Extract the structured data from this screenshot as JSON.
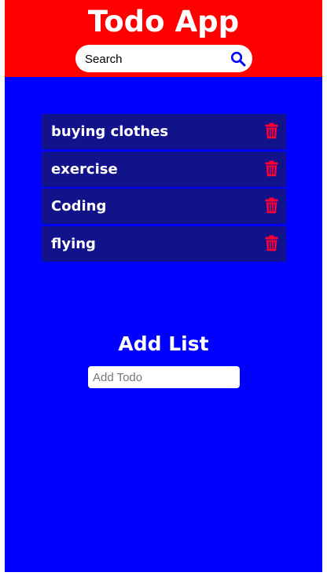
{
  "header": {
    "title": "Todo App",
    "bg_color": "#ff0000",
    "search": {
      "placeholder": "Search",
      "icon": "search-icon",
      "icon_color": "#0000ff"
    }
  },
  "main": {
    "bg_color": "#0000ff",
    "todos": [
      {
        "label": "buying clothes",
        "delete_icon": "trash-icon"
      },
      {
        "label": "exercise",
        "delete_icon": "trash-icon"
      },
      {
        "label": "Coding",
        "delete_icon": "trash-icon"
      },
      {
        "label": "flying",
        "delete_icon": "trash-icon"
      }
    ],
    "item_bg_color": "#12128a",
    "delete_icon_color": "#ff0033"
  },
  "add_section": {
    "title": "Add List",
    "input_placeholder": "Add Todo"
  }
}
